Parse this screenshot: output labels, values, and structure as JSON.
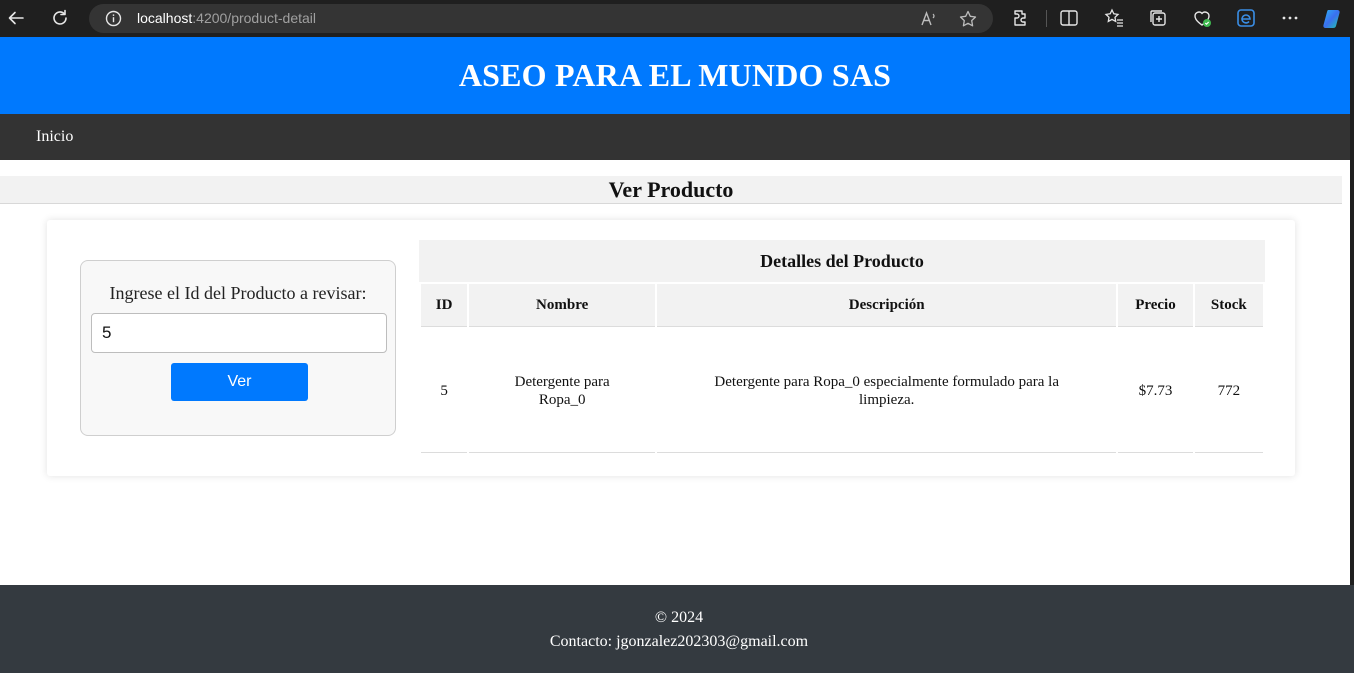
{
  "browser": {
    "url_host": "localhost",
    "url_path": ":4200/product-detail"
  },
  "header": {
    "title": "ASEO PARA EL MUNDO SAS",
    "bg_color": "#0079fe"
  },
  "navbar": {
    "home_label": "Inicio"
  },
  "page": {
    "title": "Ver Producto"
  },
  "search": {
    "label": "Ingrese el Id del Producto a revisar:",
    "value": "5",
    "button_label": "Ver"
  },
  "details": {
    "caption": "Detalles del Producto",
    "columns": [
      "ID",
      "Nombre",
      "Descripción",
      "Precio",
      "Stock"
    ],
    "row": {
      "id": "5",
      "name": "Detergente para Ropa_0",
      "description": "Detergente para Ropa_0 especialmente formulado para la limpieza.",
      "price": "$7.73",
      "stock": "772"
    }
  },
  "footer": {
    "copyright": "© 2024",
    "contact": "Contacto: jgonzalez202303@gmail.com"
  },
  "icons": [
    "back-icon",
    "refresh-icon",
    "info-icon",
    "read-aloud-icon",
    "favorite-star-icon",
    "extensions-icon",
    "split-screen-icon",
    "favorites-icon",
    "collections-icon",
    "browser-essentials-icon",
    "edge-icon",
    "more-icon",
    "copilot-icon"
  ]
}
